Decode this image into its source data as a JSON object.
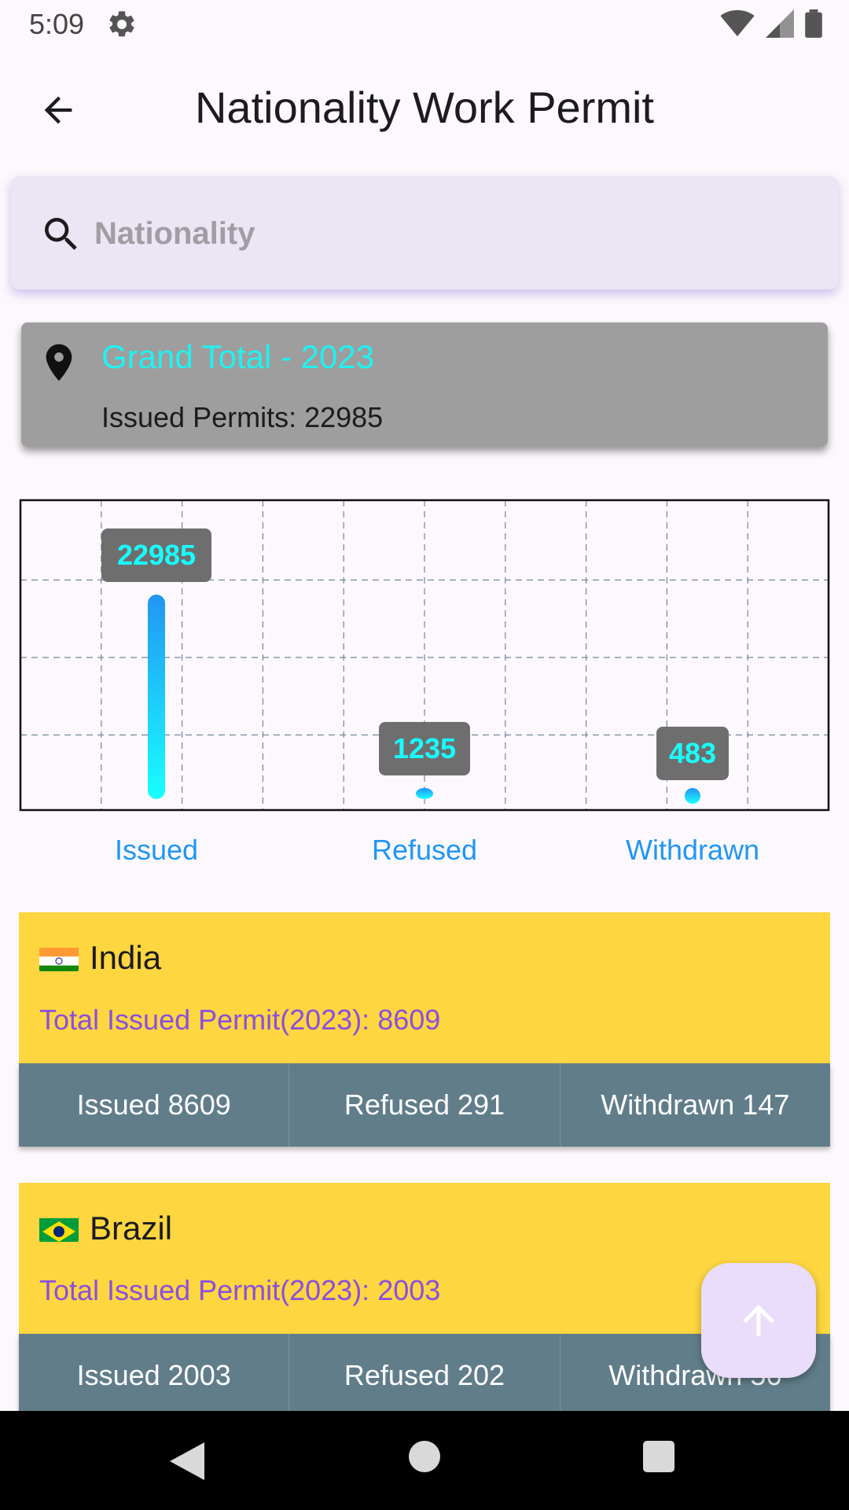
{
  "status_bar": {
    "time": "5:09"
  },
  "app_bar": {
    "title": "Nationality Work Permit"
  },
  "search": {
    "placeholder": "Nationality",
    "value": ""
  },
  "grand_total": {
    "title": "Grand Total - 2023",
    "subtitle": "Issued Permits: 22985"
  },
  "chart_data": {
    "type": "bar",
    "categories": [
      "Issued",
      "Refused",
      "Withdrawn"
    ],
    "values": [
      22985,
      1235,
      483
    ],
    "value_labels": [
      "22985",
      "1235",
      "483"
    ],
    "ylim": [
      0,
      25000
    ],
    "grid": true,
    "colors": {
      "bar_top": "#2196f3",
      "bar_bottom": "#18ffff",
      "label_bg": "#6e6e6e",
      "label_text": "#18ffff",
      "axis_label": "#2196f3"
    }
  },
  "nationalities": [
    {
      "flag": "india-flag-icon",
      "name": "India",
      "total": "Total Issued Permit(2023): 8609",
      "issued": "Issued 8609",
      "refused": "Refused 291",
      "withdrawn": "Withdrawn 147"
    },
    {
      "flag": "brazil-flag-icon",
      "name": "Brazil",
      "total": "Total Issued Permit(2023): 2003",
      "issued": "Issued 2003",
      "refused": "Refused 202",
      "withdrawn": "Withdrawn 56"
    }
  ],
  "colors": {
    "card_yellow": "#fdd640",
    "stats_bar": "#617d8a",
    "total_text": "#8a4fe0",
    "grand_total_title": "#1ff2f2"
  }
}
